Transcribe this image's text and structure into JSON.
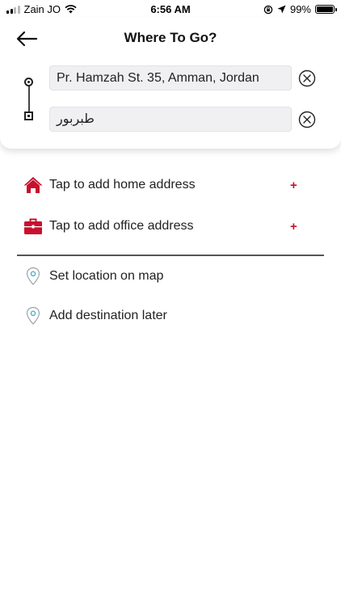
{
  "status_bar": {
    "carrier": "Zain JO",
    "time": "6:56 AM",
    "battery": "99%"
  },
  "header": {
    "title": "Where To Go?"
  },
  "route": {
    "origin_value": "Pr. Hamzah St. 35, Amman, Jordan",
    "destination_value": "طبربور"
  },
  "saved_places": [
    {
      "label": "Tap to add home address",
      "action": "+"
    },
    {
      "label": "Tap to add office address",
      "action": "+"
    }
  ],
  "options": [
    {
      "label": "Set location on map"
    },
    {
      "label": "Add destination later"
    }
  ],
  "colors": {
    "accent_red": "#c8102e",
    "pin_outline": "#9aa5aa",
    "pin_dot": "#4fb0c6"
  }
}
